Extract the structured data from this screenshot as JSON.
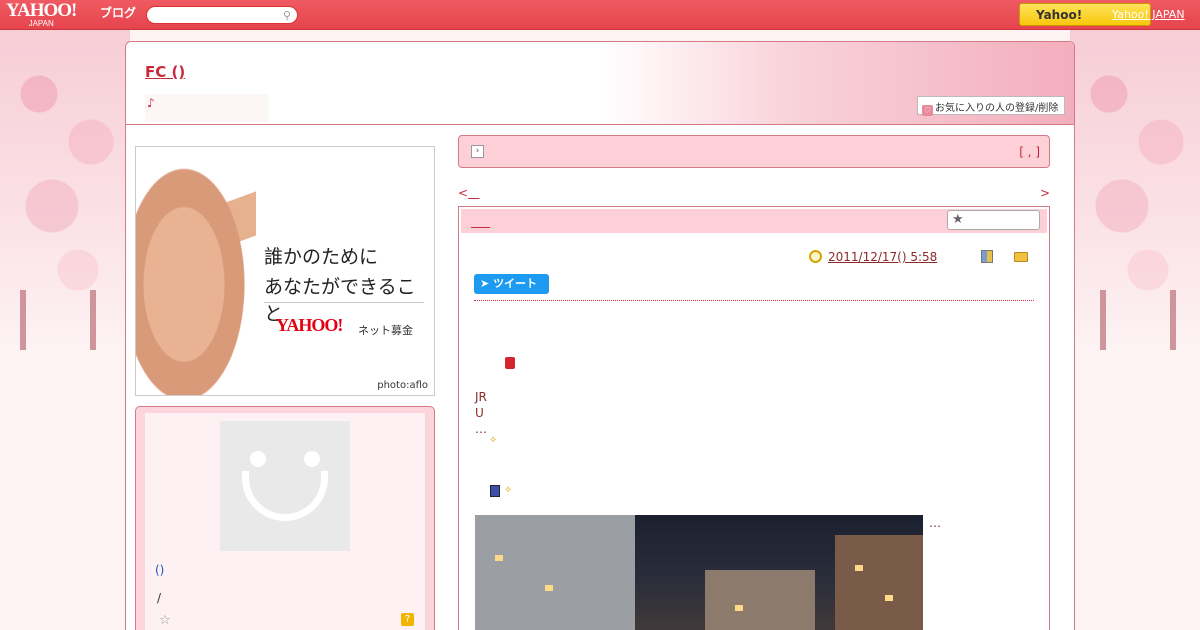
{
  "topbar": {
    "logo_main": "YAHOO!",
    "logo_sub": "JAPAN",
    "logo_blog": "ブログ",
    "search_placeholder": "",
    "yahoo_button": "Yahoo!",
    "yahoo_japan_link": "Yahoo! JAPAN"
  },
  "header": {
    "blog_title": "FC ()",
    "blog_description": "♪",
    "favorite_button": "お気に入りの人の登録/削除"
  },
  "ad": {
    "line1": "誰かのために",
    "line2": "あなたができること",
    "logo": "YAHOO!",
    "logo_sub": "ネット募金",
    "credit": "photo:aflo"
  },
  "profile": {
    "name": "()",
    "slash": "/",
    "star_glyph": "☆",
    "help_glyph": "?"
  },
  "nav": {
    "arrow": "›",
    "links": "[ , ]"
  },
  "pager": {
    "prev": "<",
    "next": ">"
  },
  "article": {
    "star_glyph": "★",
    "date": "2011/12/17()  5:58",
    "tweet": "ツイート",
    "lines": {
      "jr": "JR",
      "u": "U",
      "dots1": "…",
      "dots2": "…"
    },
    "sparkle": "✧"
  }
}
